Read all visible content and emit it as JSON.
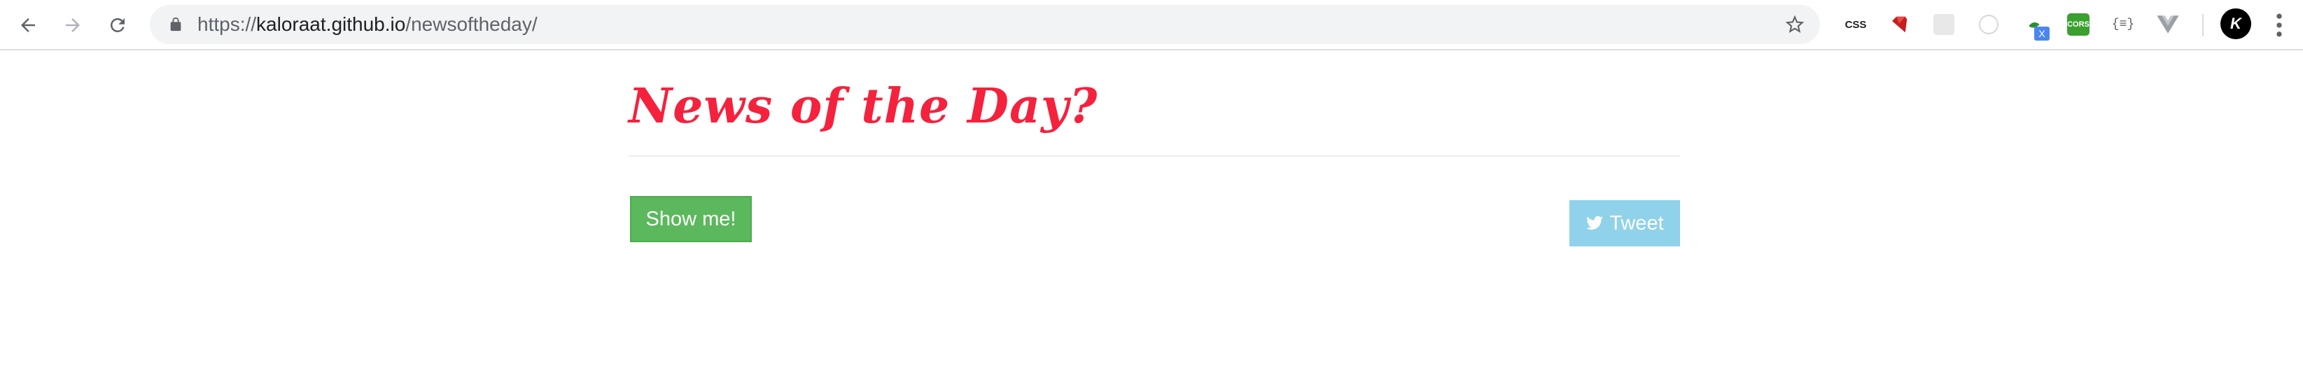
{
  "browser": {
    "url_prefix": "https://",
    "url_host": "kaloraat.github.io",
    "url_path": "/newsoftheday/",
    "extensions": {
      "css_label": "CSS",
      "badge_label": "X",
      "cors_label": "CORS",
      "json_label": "{≡}"
    },
    "profile_initial": "K"
  },
  "page": {
    "title": "News of the Day?",
    "show_button_label": "Show me!",
    "tweet_button_label": "Tweet"
  },
  "colors": {
    "title": "#f4223d",
    "show_button": "#5cb85c",
    "tweet_button": "#8fd2ea"
  }
}
